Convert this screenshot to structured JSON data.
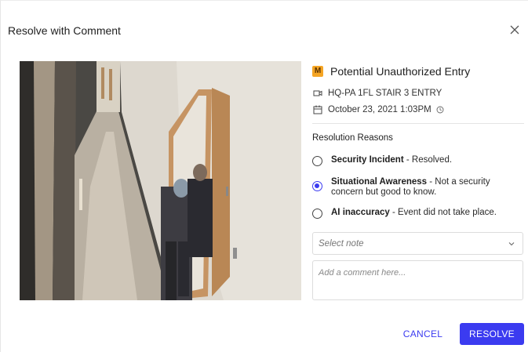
{
  "dialog": {
    "title": "Resolve with Comment",
    "close_icon": "close-icon"
  },
  "event": {
    "severity_badge": "M",
    "severity_color": "#f5a524",
    "title": "Potential Unauthorized Entry",
    "camera_icon": "camera-icon",
    "camera_name": "HQ-PA 1FL STAIR 3 ENTRY",
    "calendar_icon": "calendar-icon",
    "timestamp": "October 23, 2021 1:03PM",
    "clock_icon": "clock-icon"
  },
  "resolution": {
    "label": "Resolution Reasons",
    "options": [
      {
        "title": "Security Incident",
        "description": " - Resolved.",
        "selected": false
      },
      {
        "title": "Situational Awareness",
        "description": " - Not a security concern but good to know.",
        "selected": true
      },
      {
        "title": "AI inaccuracy",
        "description": " - Event did not take place.",
        "selected": false
      }
    ]
  },
  "note_select": {
    "placeholder": "Select note",
    "caret_icon": "chevron-down-icon"
  },
  "comment": {
    "placeholder": "Add a comment here..."
  },
  "actions": {
    "cancel_label": "CANCEL",
    "resolve_label": "RESOLVE"
  },
  "colors": {
    "accent": "#3b3bf0"
  }
}
